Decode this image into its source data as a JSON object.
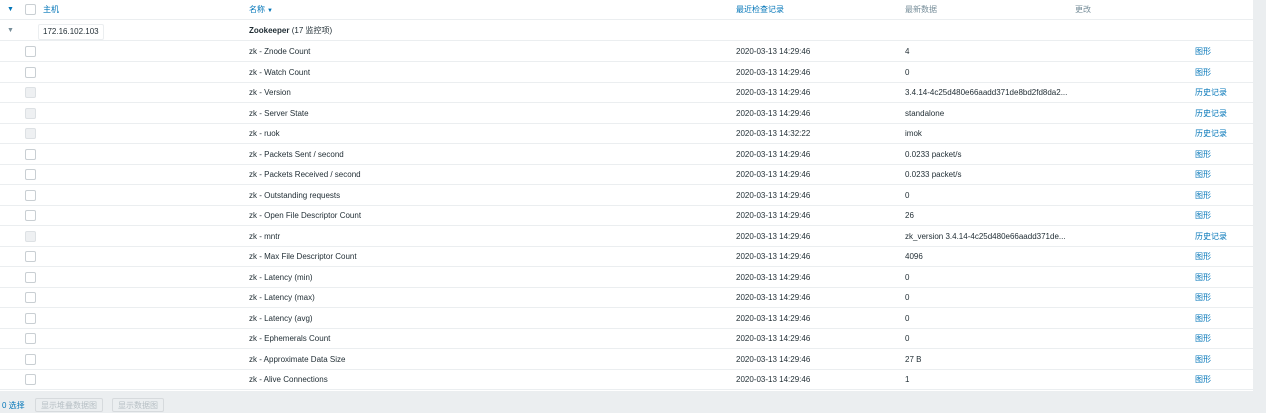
{
  "header": {
    "host": "主机",
    "name": "名称",
    "sort_icon": "sort-down-icon",
    "last_check": "最近检查记录",
    "last_value": "最新数据",
    "change": "更改"
  },
  "group": {
    "host": "172.16.102.103",
    "app_name": "Zookeeper",
    "count": "(17 监控项)"
  },
  "items": [
    {
      "name": "zk - Znode Count",
      "time": "2020-03-13 14:29:46",
      "value": "4",
      "link": "图形",
      "checkbox_enabled": true
    },
    {
      "name": "zk - Watch Count",
      "time": "2020-03-13 14:29:46",
      "value": "0",
      "link": "图形",
      "checkbox_enabled": true
    },
    {
      "name": "zk - Version",
      "time": "2020-03-13 14:29:46",
      "value": "3.4.14-4c25d480e66aadd371de8bd2fd8da2...",
      "link": "历史记录",
      "checkbox_enabled": false
    },
    {
      "name": "zk - Server State",
      "time": "2020-03-13 14:29:46",
      "value": "standalone",
      "link": "历史记录",
      "checkbox_enabled": false
    },
    {
      "name": "zk - ruok",
      "time": "2020-03-13 14:32:22",
      "value": "imok",
      "link": "历史记录",
      "checkbox_enabled": false
    },
    {
      "name": "zk - Packets Sent / second",
      "time": "2020-03-13 14:29:46",
      "value": "0.0233 packet/s",
      "link": "图形",
      "checkbox_enabled": true
    },
    {
      "name": "zk - Packets Received / second",
      "time": "2020-03-13 14:29:46",
      "value": "0.0233 packet/s",
      "link": "图形",
      "checkbox_enabled": true
    },
    {
      "name": "zk - Outstanding requests",
      "time": "2020-03-13 14:29:46",
      "value": "0",
      "link": "图形",
      "checkbox_enabled": true
    },
    {
      "name": "zk - Open File Descriptor Count",
      "time": "2020-03-13 14:29:46",
      "value": "26",
      "link": "图形",
      "checkbox_enabled": true
    },
    {
      "name": "zk - mntr",
      "time": "2020-03-13 14:29:46",
      "value": "zk_version 3.4.14-4c25d480e66aadd371de...",
      "link": "历史记录",
      "checkbox_enabled": false
    },
    {
      "name": "zk - Max File Descriptor Count",
      "time": "2020-03-13 14:29:46",
      "value": "4096",
      "link": "图形",
      "checkbox_enabled": true
    },
    {
      "name": "zk - Latency (min)",
      "time": "2020-03-13 14:29:46",
      "value": "0",
      "link": "图形",
      "checkbox_enabled": true
    },
    {
      "name": "zk - Latency (max)",
      "time": "2020-03-13 14:29:46",
      "value": "0",
      "link": "图形",
      "checkbox_enabled": true
    },
    {
      "name": "zk - Latency (avg)",
      "time": "2020-03-13 14:29:46",
      "value": "0",
      "link": "图形",
      "checkbox_enabled": true
    },
    {
      "name": "zk - Ephemerals Count",
      "time": "2020-03-13 14:29:46",
      "value": "0",
      "link": "图形",
      "checkbox_enabled": true
    },
    {
      "name": "zk - Approximate Data Size",
      "time": "2020-03-13 14:29:46",
      "value": "27 B",
      "link": "图形",
      "checkbox_enabled": true
    },
    {
      "name": "zk - Alive Connections",
      "time": "2020-03-13 14:29:46",
      "value": "1",
      "link": "图形",
      "checkbox_enabled": true
    }
  ],
  "footer": {
    "selected": "0 选择",
    "btn_stacked": "显示堆叠数据图",
    "btn_graph": "显示数据图"
  }
}
